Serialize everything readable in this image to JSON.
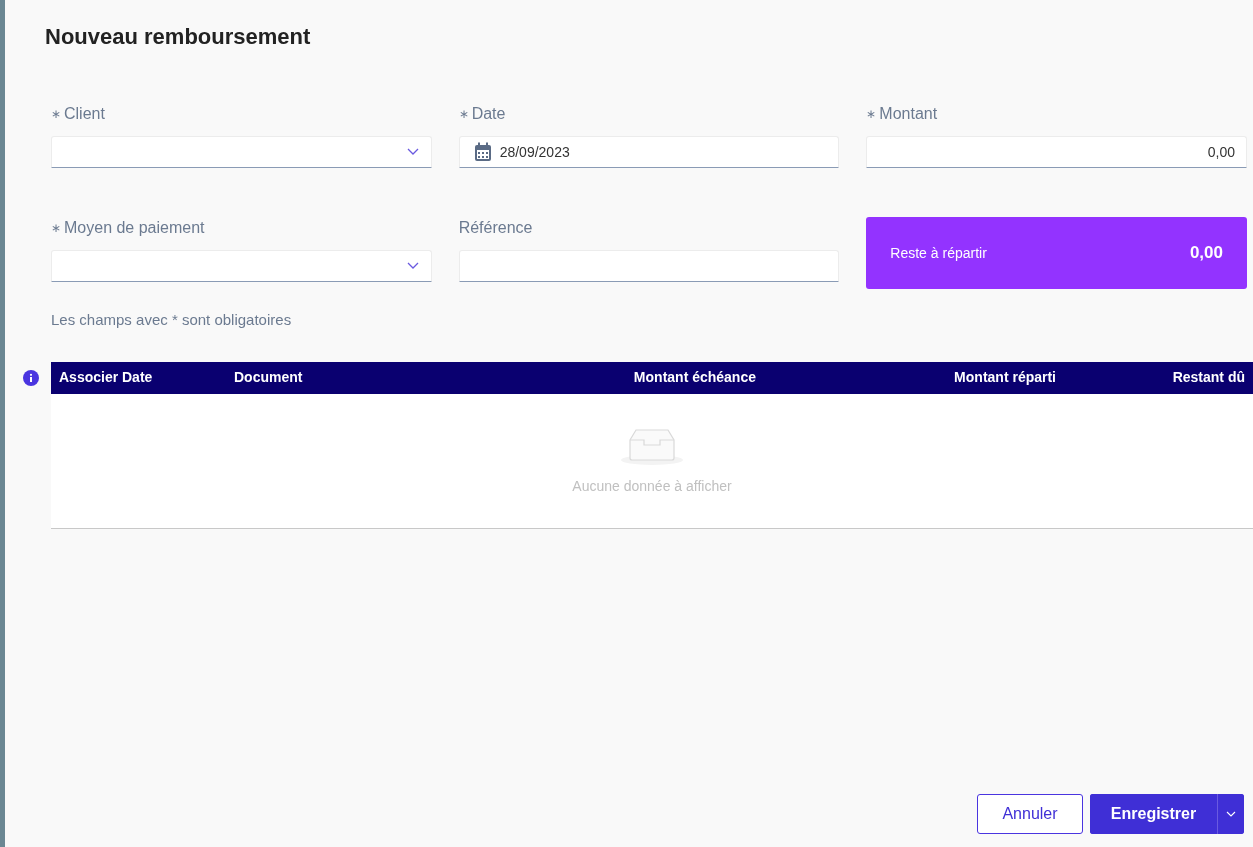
{
  "title": "Nouveau remboursement",
  "fields": [
    {
      "kind": "select",
      "mark": "∗",
      "label": "Client"
    },
    {
      "kind": "date",
      "mark": "∗",
      "label": "Date",
      "value": "28/09/2023"
    },
    {
      "kind": "number",
      "mark": "∗",
      "label": "Montant",
      "value": "0,00"
    },
    {
      "kind": "select",
      "mark": "∗",
      "label": "Moyen de paiement"
    },
    {
      "kind": "text",
      "label": "Référence"
    }
  ],
  "remaining": {
    "label": "Reste à répartir",
    "value": "0,00"
  },
  "required_note": "Les champs avec * sont obligatoires",
  "table": {
    "columns": [
      "Associer",
      "Date",
      "Document",
      "Montant échéance",
      "Montant réparti",
      "Restant dû"
    ],
    "empty_text": "Aucune donnée à afficher"
  },
  "buttons": {
    "cancel": "Annuler",
    "save": "Enregistrer"
  }
}
